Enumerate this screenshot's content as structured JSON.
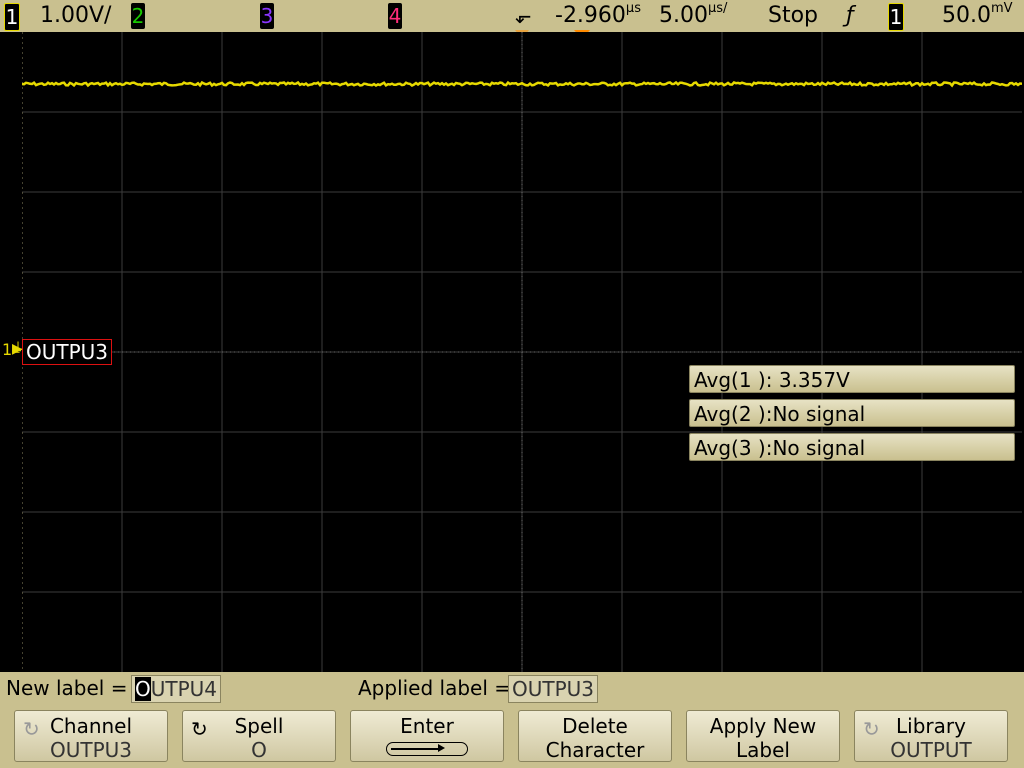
{
  "statusbar": {
    "ch1": "1",
    "ch1_scale": "1.00V/",
    "ch2": "2",
    "ch3": "3",
    "ch4": "4",
    "trigger_marker": "⬐",
    "time_delay": "-2.960",
    "time_delay_unit": "µs",
    "time_scale": "5.00",
    "time_scale_unit": "µs/",
    "run_state": "Stop",
    "trigger_slope": "ƒ",
    "trigger_source": "1",
    "trigger_level": "50.0",
    "trigger_level_unit": "mV"
  },
  "colors": {
    "bar": "#c9c08f",
    "ch1": "#e6d900",
    "ch2": "#19c800",
    "ch3": "#8a35ff",
    "ch4": "#ff2d7a",
    "trigger_marker": "#ff8a00"
  },
  "screen": {
    "channel_marker": "1",
    "channel_label": "OUTPU3"
  },
  "measurements": [
    {
      "label": "Avg(1 ): 3.357V"
    },
    {
      "label": "Avg(2 ):No signal"
    },
    {
      "label": "Avg(3 ):No signal"
    }
  ],
  "labelbar": {
    "new_label_caption": "New label =",
    "new_label_cursor": "O",
    "new_label_rest": "UTPU4",
    "applied_label_caption": "Applied label =",
    "applied_label_value": "OUTPU3"
  },
  "softkeys": [
    {
      "line1": "Channel",
      "line2": "OUTPU3"
    },
    {
      "line1": "Spell",
      "line2": "O"
    },
    {
      "line1": "Enter",
      "line2": ""
    },
    {
      "line1": "Delete",
      "line2": "Character"
    },
    {
      "line1": "Apply New",
      "line2": "Label"
    },
    {
      "line1": "Library",
      "line2": "OUTPUT"
    }
  ]
}
